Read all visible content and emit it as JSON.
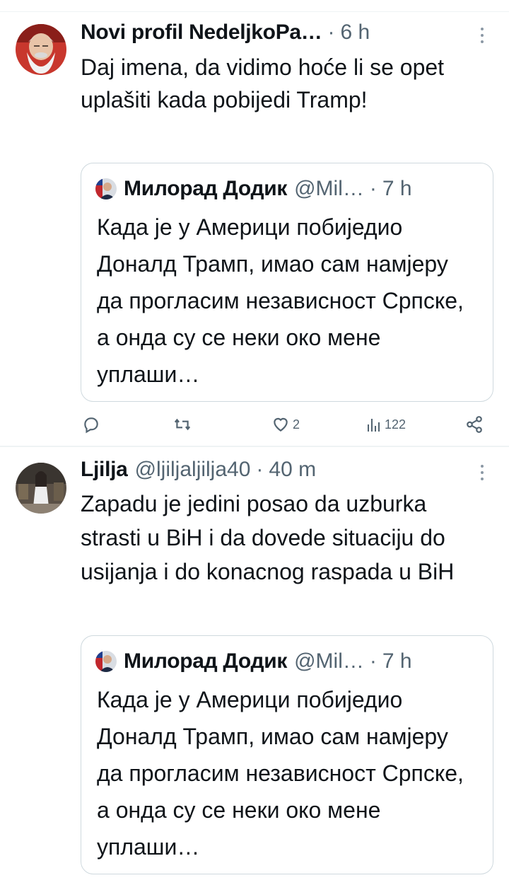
{
  "tweets": [
    {
      "author": "Novi profil NedeljkoPa…",
      "time": "6 h",
      "text": "Daj imena, da vidimo hoće li se opet uplašiti kada pobijedi Tramp!",
      "quote": {
        "author": "Милорад Додик",
        "handle": "@Mil…",
        "time": "7 h",
        "text": "Када је у Америци побиједио Доналд Трамп, имао сам намјеру да прогласим независност Српске, а онда су се неки око мене уплаши…"
      },
      "likes": "2",
      "views": "122"
    },
    {
      "author": "Ljilja",
      "handle": "@ljiljaljilja40",
      "time": "40 m",
      "text": "Zapadu je jedini posao da uzburka strasti u BiH i da dovede situaciju do usijanja i do konacnog raspada u BiH",
      "quote": {
        "author": "Милорад Додик",
        "handle": "@Mil…",
        "time": "7 h",
        "text": "Када је у Америци побиједио Доналд Трамп, имао сам намјеру да прогласим независност Српске, а онда су се неки око мене уплаши…"
      }
    }
  ],
  "separator": "·",
  "icons": {
    "reply": "reply-icon",
    "retweet": "retweet-icon",
    "like": "heart-icon",
    "views": "views-icon",
    "share": "share-icon",
    "more": "more-icon"
  },
  "colors": {
    "text": "#0f1419",
    "secondary": "#536471",
    "border": "#cfd9de"
  }
}
